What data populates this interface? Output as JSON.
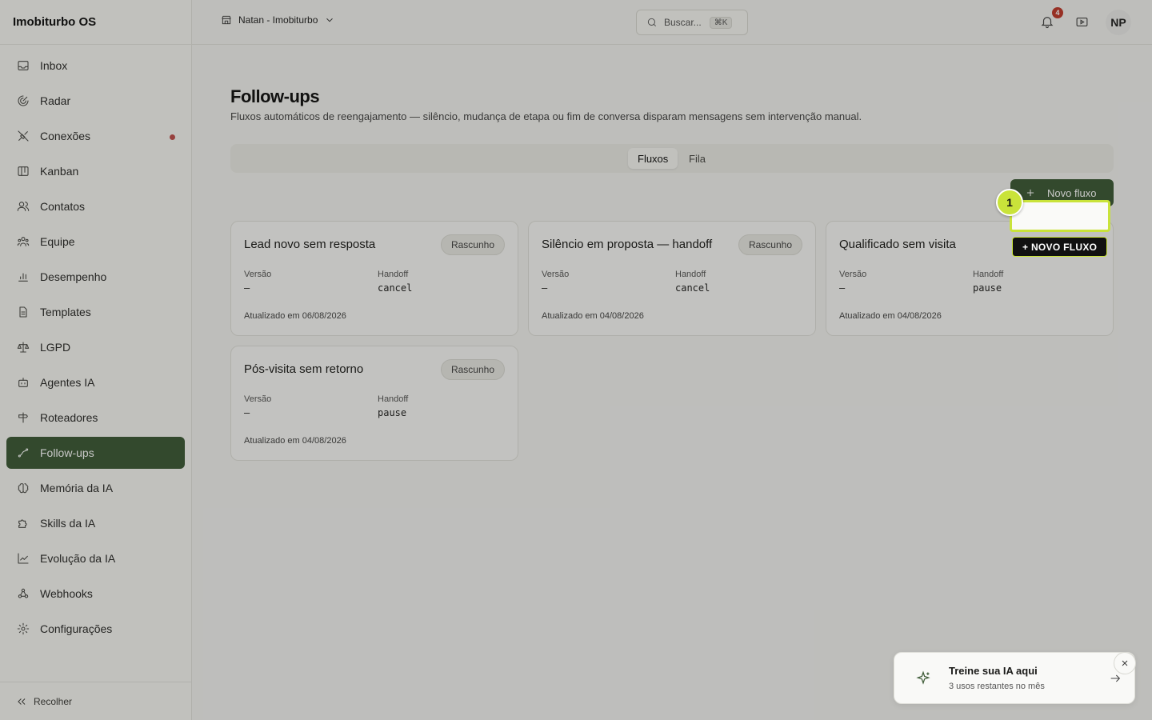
{
  "app": {
    "brand": "Imobiturbo OS"
  },
  "sidebar": {
    "items": [
      {
        "label": "Inbox",
        "icon": "inbox-icon"
      },
      {
        "label": "Radar",
        "icon": "radar-icon"
      },
      {
        "label": "Conexões",
        "icon": "connections-icon"
      },
      {
        "label": "Kanban",
        "icon": "kanban-icon"
      },
      {
        "label": "Contatos",
        "icon": "contacts-icon"
      },
      {
        "label": "Equipe",
        "icon": "team-icon"
      },
      {
        "label": "Desempenho",
        "icon": "chart-bar-icon"
      },
      {
        "label": "Templates",
        "icon": "document-icon"
      },
      {
        "label": "LGPD",
        "icon": "scale-icon"
      },
      {
        "label": "Agentes IA",
        "icon": "bot-icon"
      },
      {
        "label": "Roteadores",
        "icon": "signpost-icon"
      },
      {
        "label": "Follow-ups",
        "icon": "trend-icon"
      },
      {
        "label": "Memória da IA",
        "icon": "brain-icon"
      },
      {
        "label": "Skills da IA",
        "icon": "puzzle-icon"
      },
      {
        "label": "Evolução da IA",
        "icon": "line-chart-icon"
      },
      {
        "label": "Webhooks",
        "icon": "webhook-icon"
      },
      {
        "label": "Configurações",
        "icon": "gear-icon"
      }
    ],
    "active": "Follow-ups",
    "collapse_label": "Recolher"
  },
  "topbar": {
    "workspace": "Natan - Imobiturbo",
    "search_placeholder": "Buscar...",
    "search_shortcut": "⌘K",
    "notification_count": "4",
    "avatar_initials": "NP"
  },
  "page": {
    "title": "Follow-ups",
    "subtitle": "Fluxos automáticos de reengajamento — silêncio, mudança de etapa ou fim de conversa disparam mensagens sem intervenção manual.",
    "tabs": [
      "Fluxos",
      "Fila"
    ],
    "active_tab": "Fluxos",
    "new_button_label": "Novo fluxo"
  },
  "cards": [
    {
      "title": "Lead novo sem resposta",
      "status": "Rascunho",
      "version_label": "Versão",
      "version": "–",
      "handoff_label": "Handoff",
      "handoff": "cancel",
      "updated": "Atualizado em 06/08/2026"
    },
    {
      "title": "Silêncio em proposta — handoff",
      "status": "Rascunho",
      "version_label": "Versão",
      "version": "–",
      "handoff_label": "Handoff",
      "handoff": "cancel",
      "updated": "Atualizado em 04/08/2026"
    },
    {
      "title": "Qualificado sem visita",
      "status": "Rascunho",
      "version_label": "Versão",
      "version": "–",
      "handoff_label": "Handoff",
      "handoff": "pause",
      "updated": "Atualizado em 04/08/2026"
    },
    {
      "title": "Pós-visita sem retorno",
      "status": "Rascunho",
      "version_label": "Versão",
      "version": "–",
      "handoff_label": "Handoff",
      "handoff": "pause",
      "updated": "Atualizado em 04/08/2026"
    }
  ],
  "highlight": {
    "number": "1",
    "tag": "+ NOVO FLUXO",
    "color": "#c9e33a"
  },
  "toast": {
    "title": "Treine sua IA aqui",
    "subtitle": "3 usos restantes no mês"
  },
  "colors": {
    "accent": "#3d5a36",
    "badge": "#c0392b",
    "status_dot": "#c0504d"
  }
}
